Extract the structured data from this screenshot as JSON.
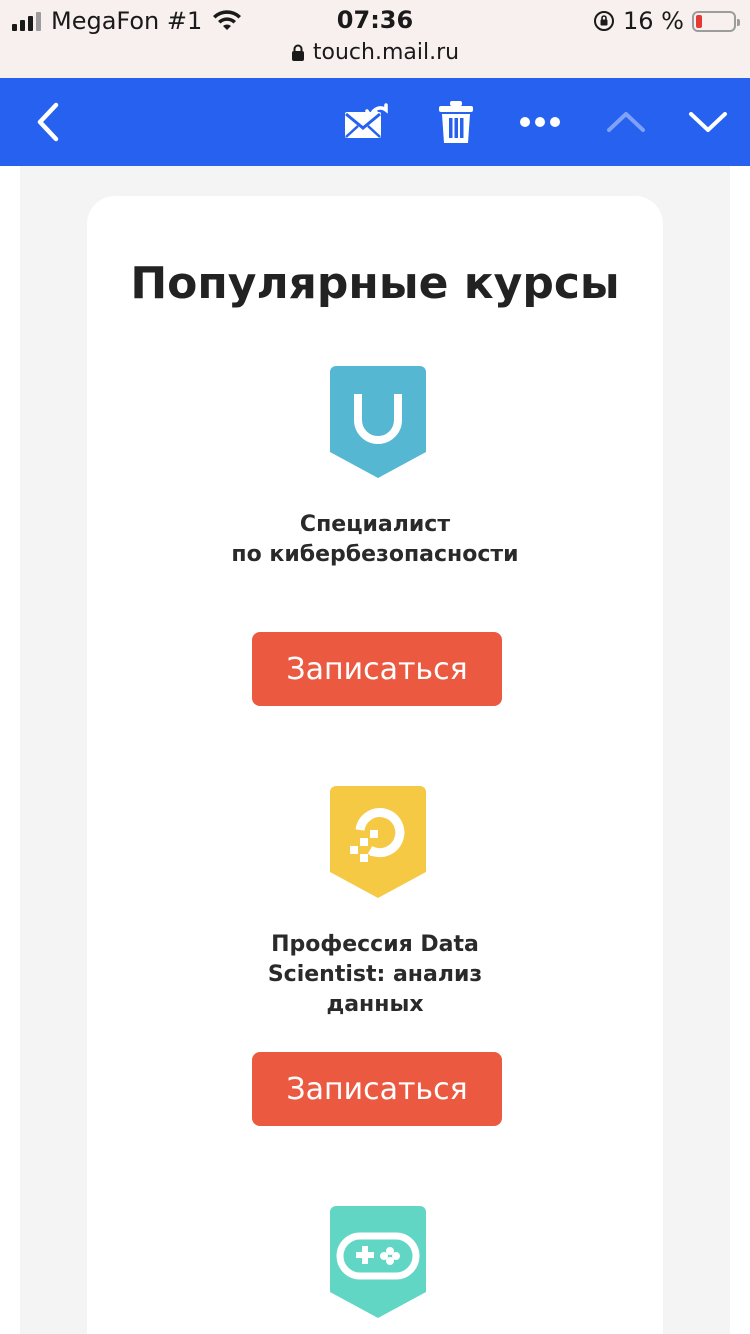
{
  "status_bar": {
    "carrier": "MegaFon #1",
    "time": "07:36",
    "battery_percent": "16 %",
    "battery_level": 0.16,
    "url": "touch.mail.ru"
  },
  "toolbar": {
    "back_icon": "chevron-left-icon",
    "move_icon": "mail-move-icon",
    "delete_icon": "trash-icon",
    "more_icon": "more-dots-icon",
    "prev_icon": "chevron-up-icon",
    "next_icon": "chevron-down-icon",
    "accent_color": "#2761f0"
  },
  "main": {
    "heading": "Популярные курсы",
    "courses": [
      {
        "title": "Специалист\nпо кибербезопасности",
        "button_label": "Записаться",
        "badge_color": "#56b7d3",
        "icon": "shield-u-icon"
      },
      {
        "title": "Профессия Data\nScientist: анализ\nданных",
        "button_label": "Записаться",
        "badge_color": "#f6c945",
        "icon": "data-pixel-icon"
      },
      {
        "title": "",
        "button_label": "",
        "badge_color": "#62d6c4",
        "icon": "gamepad-icon"
      }
    ],
    "button_color": "#ec5941"
  }
}
